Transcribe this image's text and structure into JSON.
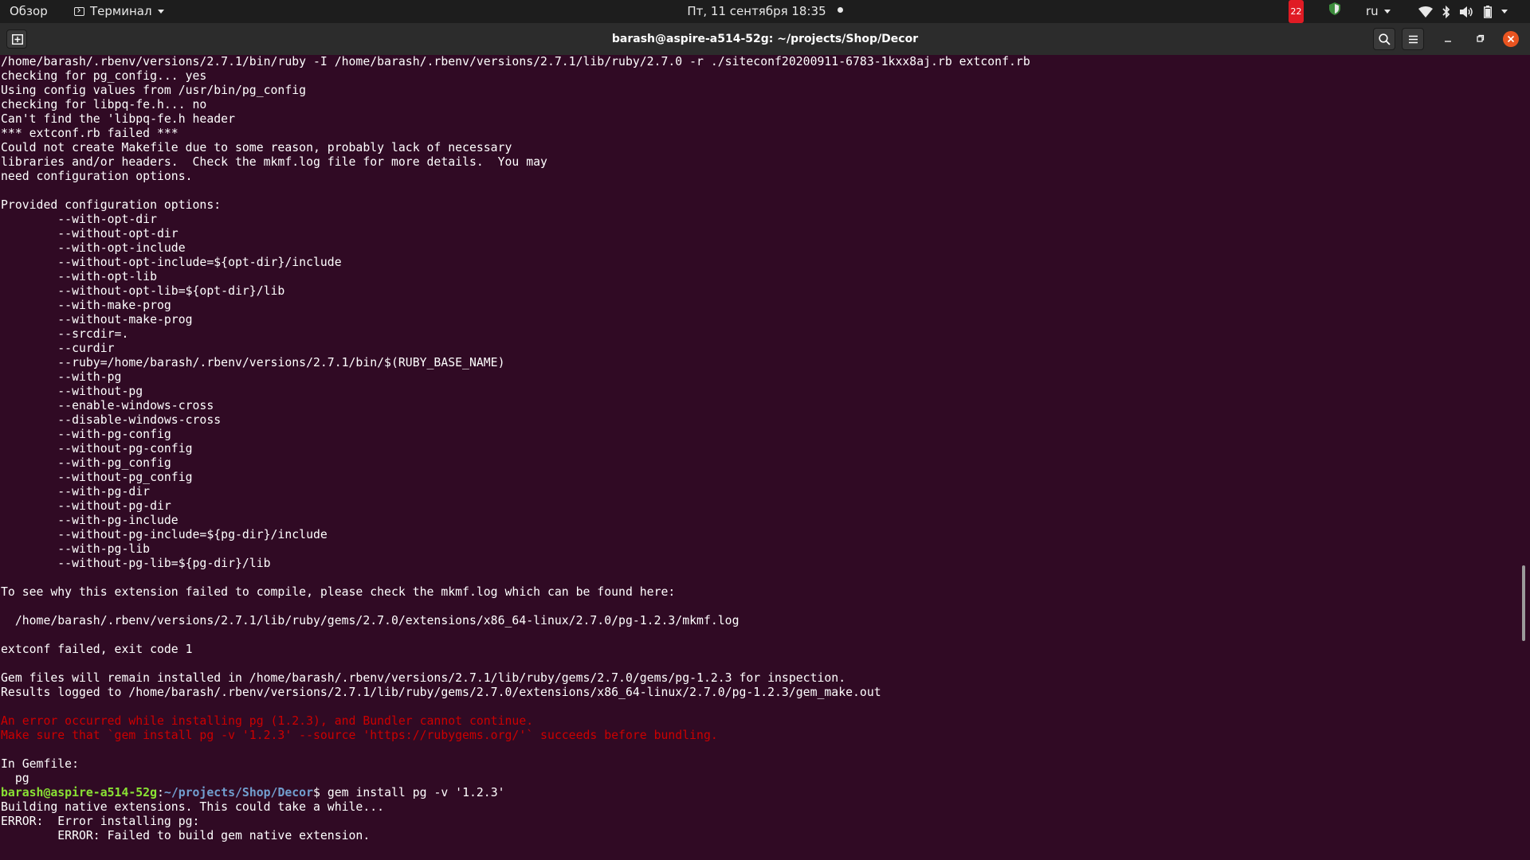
{
  "topbar": {
    "activities": "Обзор",
    "app_menu": "Терминал",
    "clock": "Пт, 11 сентября  18:35",
    "notification_count": "22",
    "keyboard_layout": "ru"
  },
  "window": {
    "title": "barash@aspire-a514-52g: ~/projects/Shop/Decor"
  },
  "terminal": {
    "lines": [
      "/home/barash/.rbenv/versions/2.7.1/bin/ruby -I /home/barash/.rbenv/versions/2.7.1/lib/ruby/2.7.0 -r ./siteconf20200911-6783-1kxx8aj.rb extconf.rb",
      "checking for pg_config... yes",
      "Using config values from /usr/bin/pg_config",
      "checking for libpq-fe.h... no",
      "Can't find the 'libpq-fe.h header",
      "*** extconf.rb failed ***",
      "Could not create Makefile due to some reason, probably lack of necessary",
      "libraries and/or headers.  Check the mkmf.log file for more details.  You may",
      "need configuration options.",
      "",
      "Provided configuration options:",
      "        --with-opt-dir",
      "        --without-opt-dir",
      "        --with-opt-include",
      "        --without-opt-include=${opt-dir}/include",
      "        --with-opt-lib",
      "        --without-opt-lib=${opt-dir}/lib",
      "        --with-make-prog",
      "        --without-make-prog",
      "        --srcdir=.",
      "        --curdir",
      "        --ruby=/home/barash/.rbenv/versions/2.7.1/bin/$(RUBY_BASE_NAME)",
      "        --with-pg",
      "        --without-pg",
      "        --enable-windows-cross",
      "        --disable-windows-cross",
      "        --with-pg-config",
      "        --without-pg-config",
      "        --with-pg_config",
      "        --without-pg_config",
      "        --with-pg-dir",
      "        --without-pg-dir",
      "        --with-pg-include",
      "        --without-pg-include=${pg-dir}/include",
      "        --with-pg-lib",
      "        --without-pg-lib=${pg-dir}/lib",
      "",
      "To see why this extension failed to compile, please check the mkmf.log which can be found here:",
      "",
      "  /home/barash/.rbenv/versions/2.7.1/lib/ruby/gems/2.7.0/extensions/x86_64-linux/2.7.0/pg-1.2.3/mkmf.log",
      "",
      "extconf failed, exit code 1",
      "",
      "Gem files will remain installed in /home/barash/.rbenv/versions/2.7.1/lib/ruby/gems/2.7.0/gems/pg-1.2.3 for inspection.",
      "Results logged to /home/barash/.rbenv/versions/2.7.1/lib/ruby/gems/2.7.0/extensions/x86_64-linux/2.7.0/pg-1.2.3/gem_make.out",
      "",
      "An error occurred while installing pg (1.2.3), and Bundler cannot continue.",
      "Make sure that `gem install pg -v '1.2.3' --source 'https://rubygems.org/'` succeeds before bundling.",
      "",
      "In Gemfile:",
      "  pg"
    ],
    "prompt_user": "barash@aspire-a514-52g",
    "prompt_sep": ":",
    "prompt_path": "~/projects/Shop/Decor",
    "prompt_command": "$ gem install pg -v '1.2.3'",
    "after_prompt": [
      "Building native extensions. This could take a while...",
      "ERROR:  Error installing pg:",
      "        ERROR: Failed to build gem native extension."
    ]
  },
  "colors": {
    "terminal_bg": "#300a24",
    "error_text": "#cc0000",
    "prompt_user": "#8ae234",
    "prompt_path": "#729fcf"
  }
}
